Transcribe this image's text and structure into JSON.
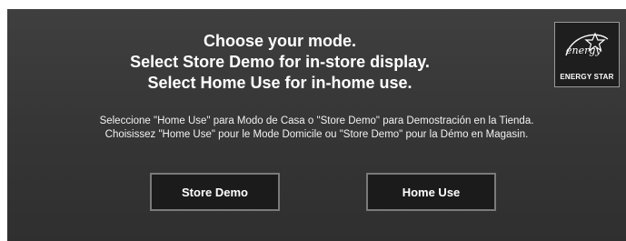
{
  "headline": {
    "line1": "Choose your mode.",
    "line2": "Select Store Demo for in-store display.",
    "line3": "Select Home Use for in-home use."
  },
  "subtext": {
    "spanish": "Seleccione \"Home Use\" para Modo de Casa o \"Store Demo\" para Demostración en la Tienda.",
    "french": "Choisissez \"Home Use\" pour le Mode Domicile ou \"Store Demo\" pour la Démo en Magasin."
  },
  "buttons": {
    "store_demo": "Store Demo",
    "home_use": "Home Use"
  },
  "energy_star": {
    "script": "energy",
    "label": "ENERGY STAR",
    "icon": "energy-star-logo"
  },
  "colors": {
    "background": "#383838",
    "button_bg": "#1b1b1b",
    "button_border": "#7a7a7a",
    "text": "#ffffff"
  }
}
